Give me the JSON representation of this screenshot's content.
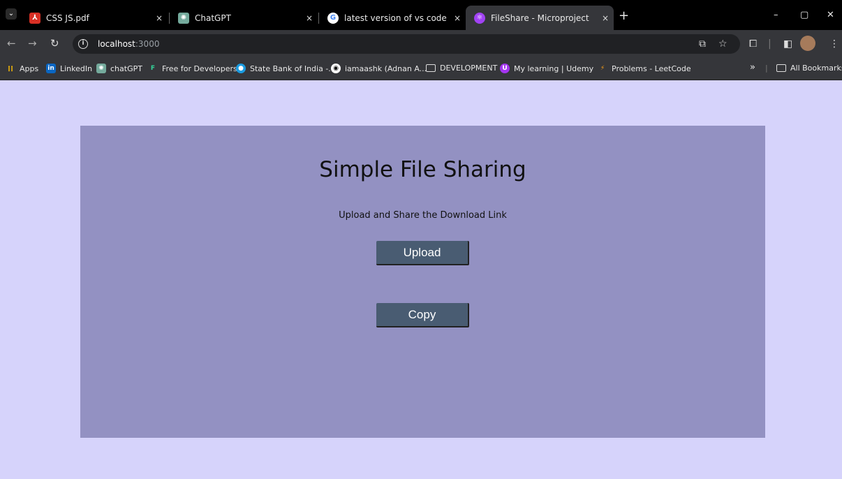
{
  "tabs": [
    {
      "title": "CSS JS.pdf",
      "icon": "pdf-icon",
      "color": "#d93025",
      "close": "×"
    },
    {
      "title": "ChatGPT",
      "icon": "chatgpt-icon",
      "color": "#74aa9c",
      "close": "×"
    },
    {
      "title": "latest version of vs code - Goog",
      "icon": "google-icon",
      "color": "#4285f4",
      "close": "×"
    },
    {
      "title": "FileShare - Microproject",
      "icon": "react-icon",
      "color": "#a142f4",
      "close": "×"
    }
  ],
  "new_tab": "+",
  "window_controls": {
    "minimize": "–",
    "restore": "▢",
    "close": "✕"
  },
  "address": {
    "host": "localhost",
    "port": ":3000"
  },
  "bookmarks": [
    {
      "label": "Apps",
      "icon": "apps-grid-icon"
    },
    {
      "label": "LinkedIn",
      "icon": "linkedin-icon"
    },
    {
      "label": "chatGPT",
      "icon": "chatgpt-icon"
    },
    {
      "label": "Free for Developers",
      "icon": "f-icon"
    },
    {
      "label": "State Bank of India -...",
      "icon": "sbi-icon"
    },
    {
      "label": "iamaashk (Adnan A...",
      "icon": "github-icon"
    },
    {
      "label": "DEVELOPMENT",
      "icon": "folder-icon"
    },
    {
      "label": "My learning | Udemy",
      "icon": "udemy-icon"
    },
    {
      "label": "Problems - LeetCode",
      "icon": "leetcode-icon"
    }
  ],
  "bookmarks_overflow": "»",
  "all_bookmarks": "All Bookmarks",
  "page": {
    "heading": "Simple File Sharing",
    "subtitle": "Upload and Share the Download Link",
    "upload_label": "Upload",
    "copy_label": "Copy"
  },
  "colors": {
    "page_bg": "#d6d3fb",
    "card_bg": "#9391c2",
    "button_bg": "#495c72"
  }
}
